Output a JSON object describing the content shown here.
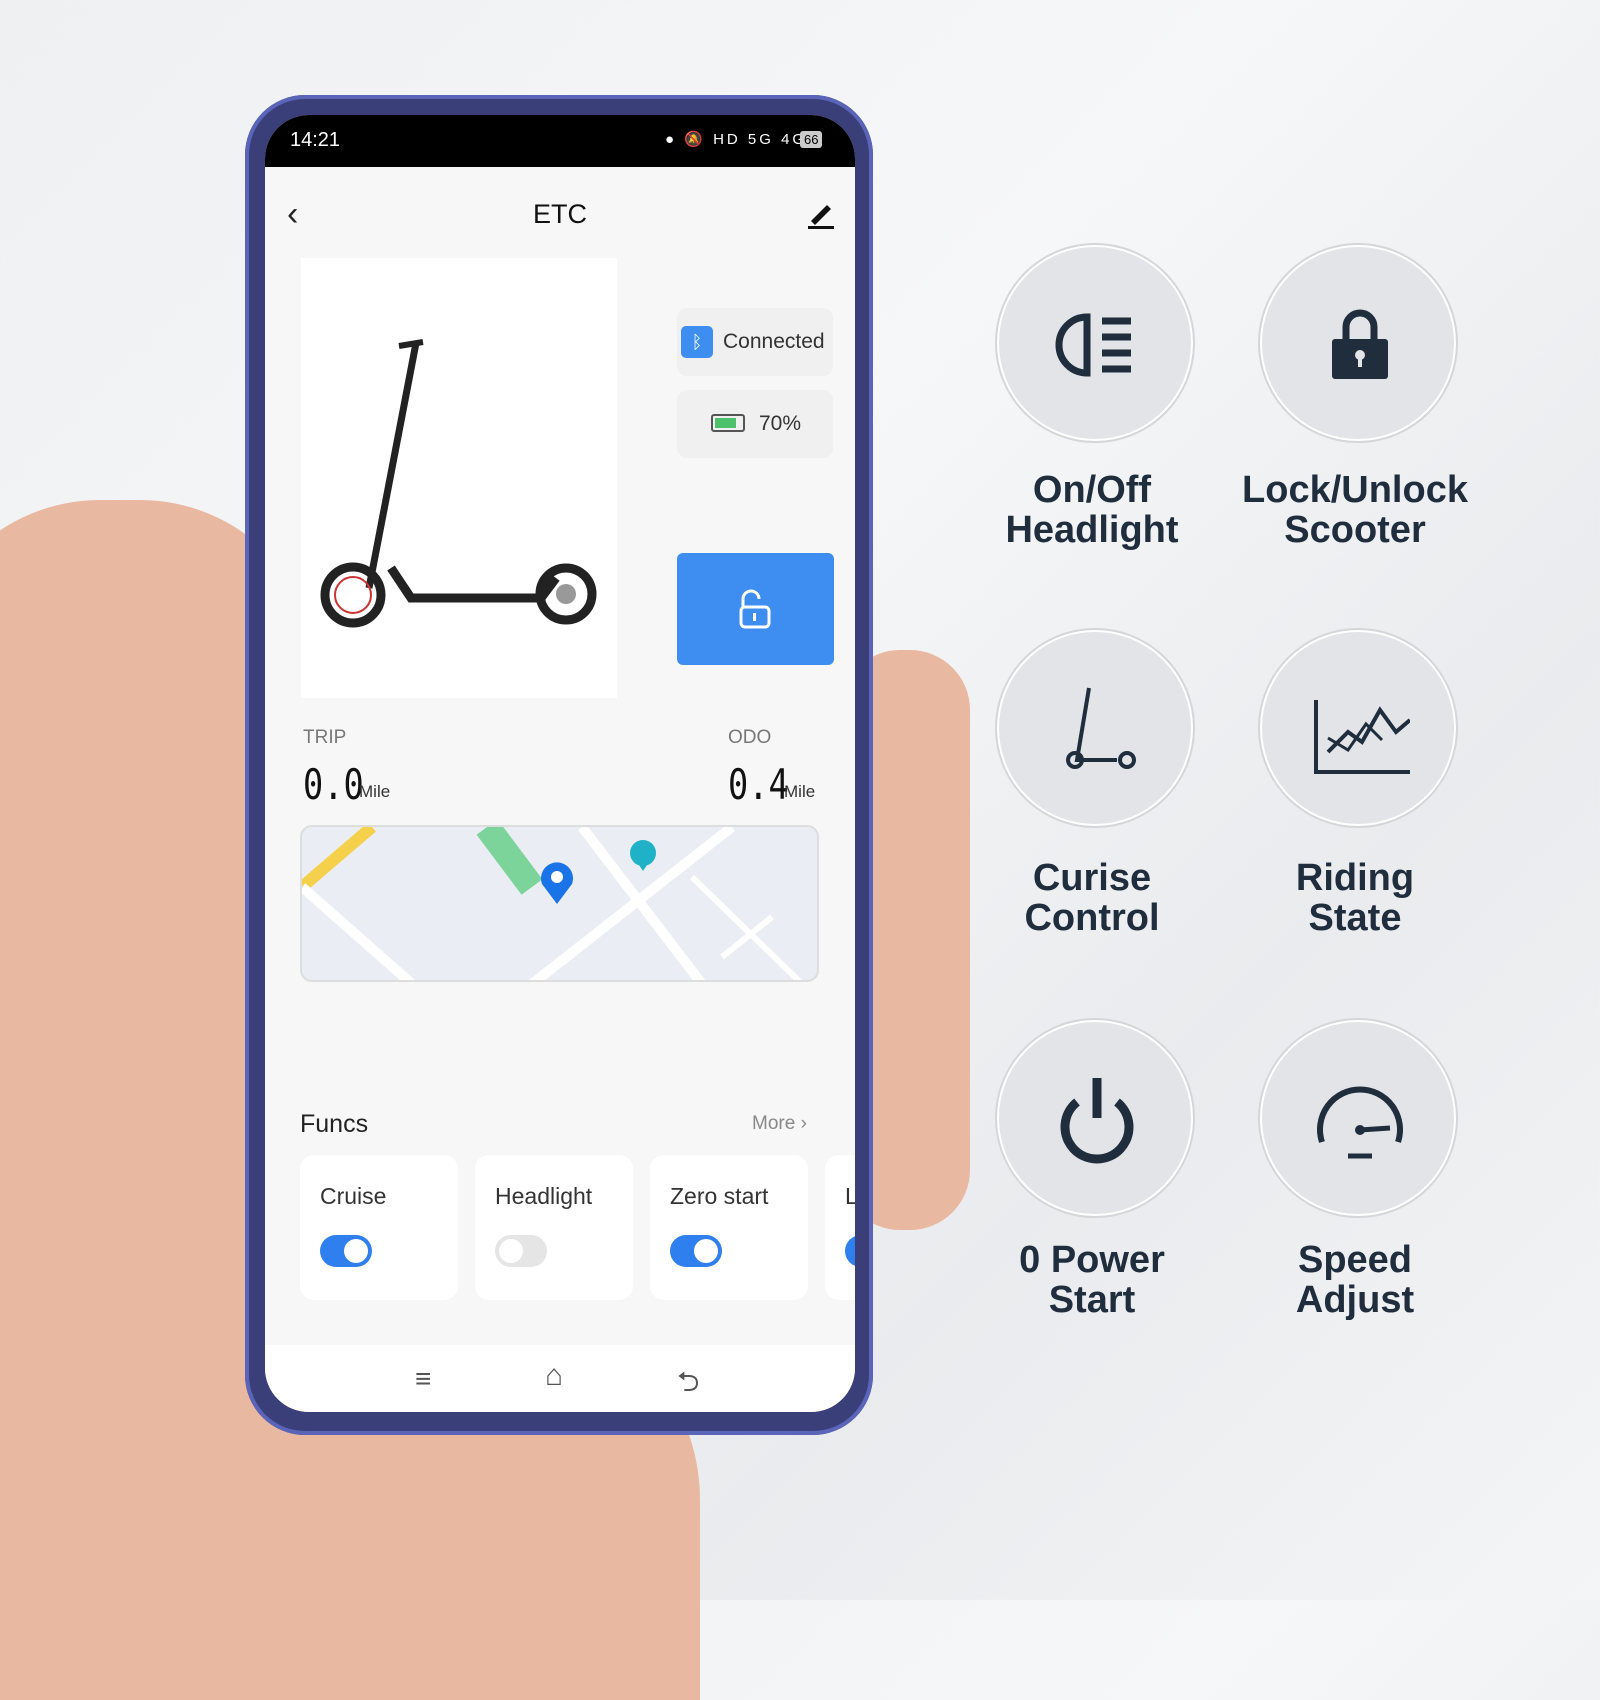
{
  "status_bar": {
    "time": "14:21",
    "battery": "66"
  },
  "header": {
    "title": "ETC"
  },
  "device": {
    "connection": "Connected",
    "battery": "70%",
    "battery_level": 0.7
  },
  "stats": {
    "trip_label": "TRIP",
    "trip_value": "0.0",
    "trip_unit": "Mile",
    "odo_label": "ODO",
    "odo_value": "0.4",
    "odo_unit": "Mile"
  },
  "funcs": {
    "title": "Funcs",
    "more": "More",
    "items": [
      {
        "label": "Cruise",
        "on": true
      },
      {
        "label": "Headlight",
        "on": false
      },
      {
        "label": "Zero start",
        "on": true
      },
      {
        "label": "L",
        "on": true
      }
    ]
  },
  "features": [
    {
      "label1": "On/Off",
      "label2": "Headlight",
      "icon": "headlight-icon"
    },
    {
      "label1": "Lock/Unlock",
      "label2": "Scooter",
      "icon": "lock-icon"
    },
    {
      "label1": "Curise",
      "label2": "Control",
      "icon": "scooter-icon"
    },
    {
      "label1": "Riding",
      "label2": "State",
      "icon": "chart-icon"
    },
    {
      "label1": "0 Power",
      "label2": "Start",
      "icon": "power-icon"
    },
    {
      "label1": "Speed",
      "label2": "Adjust",
      "icon": "speedometer-icon"
    }
  ],
  "colors": {
    "accent": "#3d8ef0",
    "toggle_on": "#2f7fee",
    "text_dark": "#1f2d3d"
  }
}
